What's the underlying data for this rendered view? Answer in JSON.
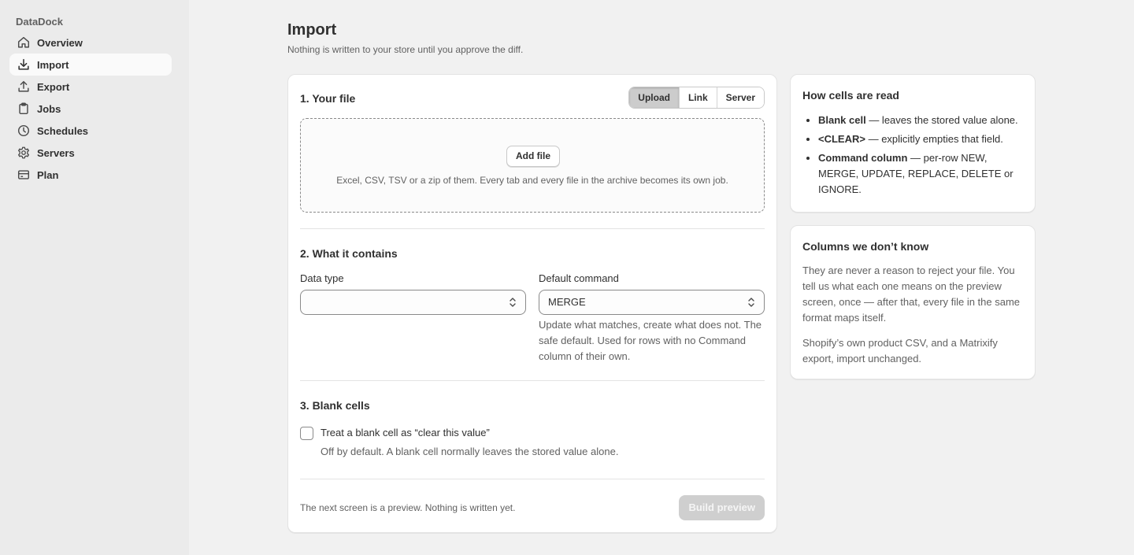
{
  "app": {
    "brand": "DataDock"
  },
  "sidebar": {
    "items": [
      {
        "label": "Overview",
        "icon": "home-icon"
      },
      {
        "label": "Import",
        "icon": "import-icon",
        "active": true
      },
      {
        "label": "Export",
        "icon": "export-icon"
      },
      {
        "label": "Jobs",
        "icon": "clipboard-icon"
      },
      {
        "label": "Schedules",
        "icon": "clock-icon"
      },
      {
        "label": "Servers",
        "icon": "gear-icon"
      },
      {
        "label": "Plan",
        "icon": "credit-card-icon"
      }
    ]
  },
  "page": {
    "title": "Import",
    "subtitle": "Nothing is written to your store until you approve the diff."
  },
  "file_section": {
    "title": "1. Your file",
    "source_tabs": [
      "Upload",
      "Link",
      "Server"
    ],
    "active_tab": "Upload",
    "add_file_label": "Add file",
    "drop_hint": "Excel, CSV, TSV or a zip of them. Every tab and every file in the archive becomes its own job."
  },
  "contains_section": {
    "title": "2. What it contains",
    "data_type_label": "Data type",
    "data_type_value": "",
    "default_command_label": "Default command",
    "default_command_value": "MERGE",
    "default_command_help": "Update what matches, create what does not. The safe default. Used for rows with no Command column of their own."
  },
  "blank_section": {
    "title": "3. Blank cells",
    "checkbox_label": "Treat a blank cell as “clear this value”",
    "checkbox_checked": false,
    "checkbox_help": "Off by default. A blank cell normally leaves the stored value alone."
  },
  "footer": {
    "note": "The next screen is a preview. Nothing is written yet.",
    "build_preview_label": "Build preview"
  },
  "cells_card": {
    "title": "How cells are read",
    "items": [
      {
        "term": "Blank cell",
        "desc": " — leaves the stored value alone."
      },
      {
        "term": "<CLEAR>",
        "desc": " — explicitly empties that field."
      },
      {
        "term": "Command column",
        "desc": " — per-row NEW, MERGE, UPDATE, REPLACE, DELETE or IGNORE."
      }
    ]
  },
  "unknown_card": {
    "title": "Columns we don’t know",
    "para1": "They are never a reason to reject your file. You tell us what each one means on the preview screen, once — after that, every file in the same format maps itself.",
    "para2": "Shopify’s own product CSV, and a Matrixify export, import unchanged."
  },
  "colors": {
    "background": "#f1f1f1",
    "sidebar": "#ebebeb",
    "card": "#ffffff",
    "text": "#303030",
    "muted": "#616161",
    "disabled_button": "#cfcfcf"
  }
}
